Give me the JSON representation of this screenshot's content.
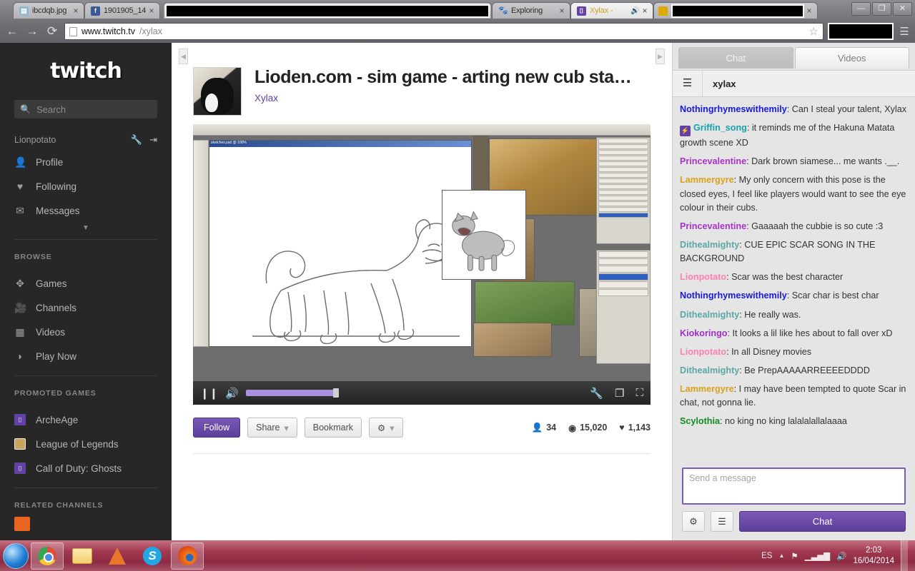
{
  "browser": {
    "tabs": [
      {
        "title": "ibcdqb.jpg",
        "favicon": "image-icon",
        "favicon_color": "#8fb7d4",
        "redacted": false,
        "active": false,
        "muted": false
      },
      {
        "title": "1901905_14",
        "favicon": "facebook-icon",
        "favicon_color": "#3b5998",
        "redacted": false,
        "active": false,
        "muted": false
      },
      {
        "title": "",
        "favicon": "",
        "favicon_color": "#000000",
        "redacted": true,
        "active": false,
        "muted": false
      },
      {
        "title": "Exploring",
        "favicon": "paw-icon",
        "favicon_color": "#b05a2a",
        "redacted": false,
        "active": false,
        "muted": false
      },
      {
        "title": "Xylax -",
        "favicon": "twitch-icon",
        "favicon_color": "#6441a5",
        "redacted": false,
        "active": true,
        "muted": true
      },
      {
        "title": "",
        "favicon": "",
        "favicon_color": "#000000",
        "redacted": true,
        "active": false,
        "muted": false
      }
    ],
    "close_label": "×",
    "mute_icon": "speaker-icon",
    "window_buttons": [
      "minimize",
      "restore",
      "close"
    ],
    "nav": {
      "back_icon": "←",
      "forward_icon": "→",
      "reload_icon": "⟳",
      "url_host": "www.twitch.tv",
      "url_path": "/xylax",
      "bookmark_icon": "☆",
      "menu_icon": "menu-icon"
    }
  },
  "sidebar": {
    "logo": "twitch",
    "search": {
      "placeholder": "Search",
      "icon": "search-icon"
    },
    "account": {
      "name": "Lionpotato",
      "settings_icon": "wrench-icon",
      "logout_icon": "logout-icon"
    },
    "user_items": [
      {
        "label": "Profile",
        "icon": "person-icon"
      },
      {
        "label": "Following",
        "icon": "heart-icon"
      },
      {
        "label": "Messages",
        "icon": "envelope-icon"
      }
    ],
    "expand_icon": "▼",
    "browse_header": "BROWSE",
    "browse_items": [
      {
        "label": "Games",
        "icon": "gamepad-icon"
      },
      {
        "label": "Channels",
        "icon": "video-camera-icon"
      },
      {
        "label": "Videos",
        "icon": "grid-icon"
      },
      {
        "label": "Play Now",
        "icon": "play-now-icon"
      }
    ],
    "promoted_header": "PROMOTED GAMES",
    "promoted_items": [
      {
        "label": "ArcheAge",
        "color": "#6441a5"
      },
      {
        "label": "League of Legends",
        "color": "#caa35e"
      },
      {
        "label": "Call of Duty: Ghosts",
        "color": "#6441a5"
      }
    ],
    "related_header": "RELATED CHANNELS"
  },
  "stream": {
    "title": "Lioden.com - sim game - arting new cub sta…",
    "channel": "Xylax",
    "avatar_name": "channel-avatar",
    "collapse_left_icon": "◀",
    "collapse_right_icon": "▶",
    "player": {
      "pause_icon": "❙❙",
      "volume_icon": "🔊",
      "settings_icon": "wrench-icon",
      "theatre_icon": "theatre-mode-icon",
      "fullscreen_icon": "fullscreen-icon"
    },
    "actions": {
      "follow": "Follow",
      "share": "Share",
      "bookmark": "Bookmark",
      "gear": "⚙",
      "caret": "▾"
    },
    "stats": {
      "viewers_icon": "viewer-icon",
      "viewers": "34",
      "views_icon": "eye-icon",
      "views": "15,020",
      "followers_icon": "heart-icon",
      "followers": "1,143"
    }
  },
  "chat": {
    "tabs": [
      {
        "label": "Chat",
        "active": true
      },
      {
        "label": "Videos",
        "active": false
      }
    ],
    "menu_icon": "hamburger-icon",
    "channel": "xylax",
    "messages": [
      {
        "user": "Nothingrhymeswithemily",
        "color": "#1818e0",
        "text": "Can I steal your talent, Xylax",
        "badge": null
      },
      {
        "user": "Griffin_song",
        "color": "#14a2ab",
        "text": "it reminds me of the Hakuna Matata growth scene XD",
        "badge": "turbo"
      },
      {
        "user": "Princevalentine",
        "color": "#a833c8",
        "text": "Dark brown siamese... me wants .__.",
        "badge": null
      },
      {
        "user": "Lammergyre",
        "color": "#d9a11a",
        "text": "My only concern with this pose is the closed eyes, I feel like players would want to see the eye colour in their cubs.",
        "badge": null
      },
      {
        "user": "Princevalentine",
        "color": "#a833c8",
        "text": "Gaaaaah the cubbie is so cute :3",
        "badge": null
      },
      {
        "user": "Dithealmighty",
        "color": "#5ba8a4",
        "text": "CUE EPIC SCAR SONG IN THE BACKGROUND",
        "badge": null
      },
      {
        "user": "Lionpotato",
        "color": "#ff7fb0",
        "text": "Scar was the best character",
        "badge": null
      },
      {
        "user": "Nothingrhymeswithemily",
        "color": "#1818e0",
        "text": "Scar char is best char",
        "badge": null
      },
      {
        "user": "Dithealmighty",
        "color": "#5ba8a4",
        "text": "He really was.",
        "badge": null
      },
      {
        "user": "Kiokoringo",
        "color": "#9b2fc9",
        "text": "It looks a lil like hes about to fall over xD",
        "badge": null
      },
      {
        "user": "Lionpotato",
        "color": "#ff7fb0",
        "text": "In all Disney movies",
        "badge": null
      },
      {
        "user": "Dithealmighty",
        "color": "#5ba8a4",
        "text": "Be PrepAAAAARREEEEDDDD",
        "badge": null
      },
      {
        "user": "Lammergyre",
        "color": "#d9a11a",
        "text": "I may have been tempted to quote Scar in chat, not gonna lie.",
        "badge": null
      },
      {
        "user": "Scylothia",
        "color": "#0f8f22",
        "text": "no king no king lalalalallalaaaa",
        "badge": null
      }
    ],
    "input_placeholder": "Send a message",
    "settings_icon": "gear-icon",
    "userlist_icon": "list-icon",
    "send_label": "Chat"
  },
  "taskbar": {
    "start_label": "start-orb",
    "items": [
      {
        "name": "chrome",
        "open": true
      },
      {
        "name": "explorer",
        "open": false
      },
      {
        "name": "vlc",
        "open": false
      },
      {
        "name": "skype",
        "open": false
      },
      {
        "name": "firefox",
        "open": true
      }
    ],
    "tray": {
      "language": "ES",
      "expand_icon": "▲",
      "action_center_icon": "flag-icon",
      "network_icon": "signal-icon",
      "volume_icon": "speaker-icon",
      "time": "2:03",
      "date": "16/04/2014"
    }
  },
  "colors": {
    "twitch_purple": "#6441a5",
    "sidebar_bg": "#272727",
    "chat_bg": "#e5e5e5"
  }
}
